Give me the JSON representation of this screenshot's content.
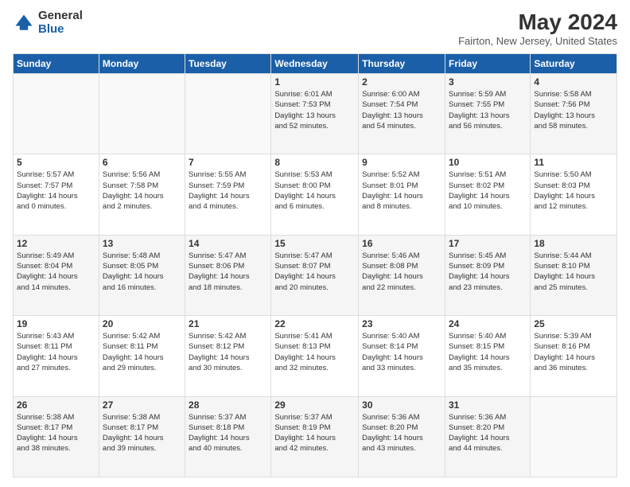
{
  "header": {
    "logo_general": "General",
    "logo_blue": "Blue",
    "title": "May 2024",
    "subtitle": "Fairton, New Jersey, United States"
  },
  "columns": [
    "Sunday",
    "Monday",
    "Tuesday",
    "Wednesday",
    "Thursday",
    "Friday",
    "Saturday"
  ],
  "weeks": [
    [
      {
        "day": "",
        "info": ""
      },
      {
        "day": "",
        "info": ""
      },
      {
        "day": "",
        "info": ""
      },
      {
        "day": "1",
        "info": "Sunrise: 6:01 AM\nSunset: 7:53 PM\nDaylight: 13 hours\nand 52 minutes."
      },
      {
        "day": "2",
        "info": "Sunrise: 6:00 AM\nSunset: 7:54 PM\nDaylight: 13 hours\nand 54 minutes."
      },
      {
        "day": "3",
        "info": "Sunrise: 5:59 AM\nSunset: 7:55 PM\nDaylight: 13 hours\nand 56 minutes."
      },
      {
        "day": "4",
        "info": "Sunrise: 5:58 AM\nSunset: 7:56 PM\nDaylight: 13 hours\nand 58 minutes."
      }
    ],
    [
      {
        "day": "5",
        "info": "Sunrise: 5:57 AM\nSunset: 7:57 PM\nDaylight: 14 hours\nand 0 minutes."
      },
      {
        "day": "6",
        "info": "Sunrise: 5:56 AM\nSunset: 7:58 PM\nDaylight: 14 hours\nand 2 minutes."
      },
      {
        "day": "7",
        "info": "Sunrise: 5:55 AM\nSunset: 7:59 PM\nDaylight: 14 hours\nand 4 minutes."
      },
      {
        "day": "8",
        "info": "Sunrise: 5:53 AM\nSunset: 8:00 PM\nDaylight: 14 hours\nand 6 minutes."
      },
      {
        "day": "9",
        "info": "Sunrise: 5:52 AM\nSunset: 8:01 PM\nDaylight: 14 hours\nand 8 minutes."
      },
      {
        "day": "10",
        "info": "Sunrise: 5:51 AM\nSunset: 8:02 PM\nDaylight: 14 hours\nand 10 minutes."
      },
      {
        "day": "11",
        "info": "Sunrise: 5:50 AM\nSunset: 8:03 PM\nDaylight: 14 hours\nand 12 minutes."
      }
    ],
    [
      {
        "day": "12",
        "info": "Sunrise: 5:49 AM\nSunset: 8:04 PM\nDaylight: 14 hours\nand 14 minutes."
      },
      {
        "day": "13",
        "info": "Sunrise: 5:48 AM\nSunset: 8:05 PM\nDaylight: 14 hours\nand 16 minutes."
      },
      {
        "day": "14",
        "info": "Sunrise: 5:47 AM\nSunset: 8:06 PM\nDaylight: 14 hours\nand 18 minutes."
      },
      {
        "day": "15",
        "info": "Sunrise: 5:47 AM\nSunset: 8:07 PM\nDaylight: 14 hours\nand 20 minutes."
      },
      {
        "day": "16",
        "info": "Sunrise: 5:46 AM\nSunset: 8:08 PM\nDaylight: 14 hours\nand 22 minutes."
      },
      {
        "day": "17",
        "info": "Sunrise: 5:45 AM\nSunset: 8:09 PM\nDaylight: 14 hours\nand 23 minutes."
      },
      {
        "day": "18",
        "info": "Sunrise: 5:44 AM\nSunset: 8:10 PM\nDaylight: 14 hours\nand 25 minutes."
      }
    ],
    [
      {
        "day": "19",
        "info": "Sunrise: 5:43 AM\nSunset: 8:11 PM\nDaylight: 14 hours\nand 27 minutes."
      },
      {
        "day": "20",
        "info": "Sunrise: 5:42 AM\nSunset: 8:11 PM\nDaylight: 14 hours\nand 29 minutes."
      },
      {
        "day": "21",
        "info": "Sunrise: 5:42 AM\nSunset: 8:12 PM\nDaylight: 14 hours\nand 30 minutes."
      },
      {
        "day": "22",
        "info": "Sunrise: 5:41 AM\nSunset: 8:13 PM\nDaylight: 14 hours\nand 32 minutes."
      },
      {
        "day": "23",
        "info": "Sunrise: 5:40 AM\nSunset: 8:14 PM\nDaylight: 14 hours\nand 33 minutes."
      },
      {
        "day": "24",
        "info": "Sunrise: 5:40 AM\nSunset: 8:15 PM\nDaylight: 14 hours\nand 35 minutes."
      },
      {
        "day": "25",
        "info": "Sunrise: 5:39 AM\nSunset: 8:16 PM\nDaylight: 14 hours\nand 36 minutes."
      }
    ],
    [
      {
        "day": "26",
        "info": "Sunrise: 5:38 AM\nSunset: 8:17 PM\nDaylight: 14 hours\nand 38 minutes."
      },
      {
        "day": "27",
        "info": "Sunrise: 5:38 AM\nSunset: 8:17 PM\nDaylight: 14 hours\nand 39 minutes."
      },
      {
        "day": "28",
        "info": "Sunrise: 5:37 AM\nSunset: 8:18 PM\nDaylight: 14 hours\nand 40 minutes."
      },
      {
        "day": "29",
        "info": "Sunrise: 5:37 AM\nSunset: 8:19 PM\nDaylight: 14 hours\nand 42 minutes."
      },
      {
        "day": "30",
        "info": "Sunrise: 5:36 AM\nSunset: 8:20 PM\nDaylight: 14 hours\nand 43 minutes."
      },
      {
        "day": "31",
        "info": "Sunrise: 5:36 AM\nSunset: 8:20 PM\nDaylight: 14 hours\nand 44 minutes."
      },
      {
        "day": "",
        "info": ""
      }
    ]
  ]
}
